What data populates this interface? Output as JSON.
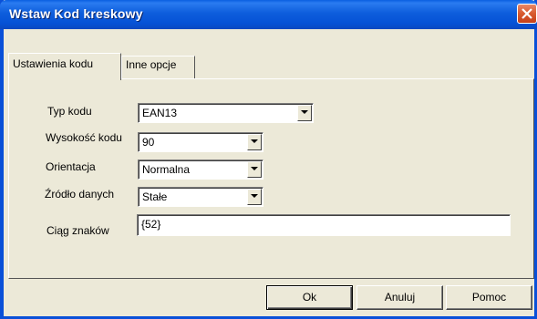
{
  "window": {
    "title": "Wstaw Kod kreskowy",
    "close_icon": "close-icon"
  },
  "tabs": [
    {
      "label": "Ustawienia kodu",
      "active": true
    },
    {
      "label": "Inne opcje",
      "active": false
    }
  ],
  "form": {
    "typ_kodu": {
      "label": "Typ kodu",
      "value": "EAN13"
    },
    "wysokosc": {
      "label": "Wysokość kodu",
      "value": "90"
    },
    "orientacja": {
      "label": "Orientacja",
      "value": "Normalna"
    },
    "zrodlo": {
      "label": "Źródło danych",
      "value": "Stałe"
    },
    "ciag": {
      "label": "Ciąg znaków",
      "value": "{52}"
    }
  },
  "buttons": {
    "ok": "Ok",
    "cancel": "Anuluj",
    "help": "Pomoc"
  }
}
